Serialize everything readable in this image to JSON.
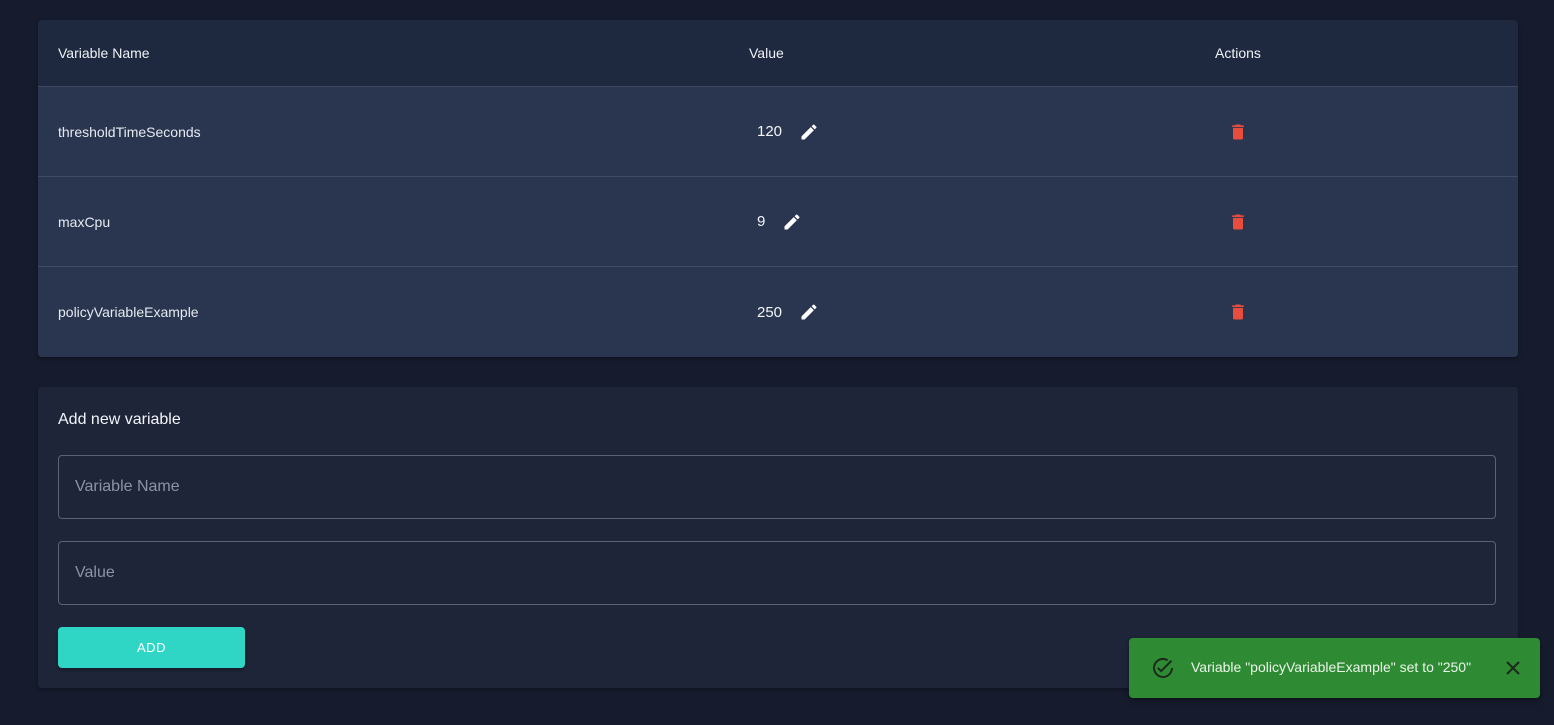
{
  "table": {
    "headers": {
      "name": "Variable Name",
      "value": "Value",
      "actions": "Actions"
    },
    "rows": [
      {
        "name": "thresholdTimeSeconds",
        "value": "120"
      },
      {
        "name": "maxCpu",
        "value": "9"
      },
      {
        "name": "policyVariableExample",
        "value": "250"
      }
    ],
    "icons": {
      "edit": "pencil-icon",
      "delete": "trash-icon"
    }
  },
  "add_form": {
    "title": "Add new variable",
    "name_placeholder": "Variable Name",
    "value_placeholder": "Value",
    "name_value": "",
    "value_value": "",
    "add_label": "ADD"
  },
  "toast": {
    "message": "Variable \"policyVariableExample\" set to \"250\"",
    "icon": "check-circle-icon",
    "close_icon": "close-icon"
  },
  "colors": {
    "background": "#161c2e",
    "table_header": "#1e293f",
    "table_row": "#2a3650",
    "delete": "#e74c3c",
    "accent": "#2fd5c5",
    "toast_success": "#2e8b33"
  }
}
